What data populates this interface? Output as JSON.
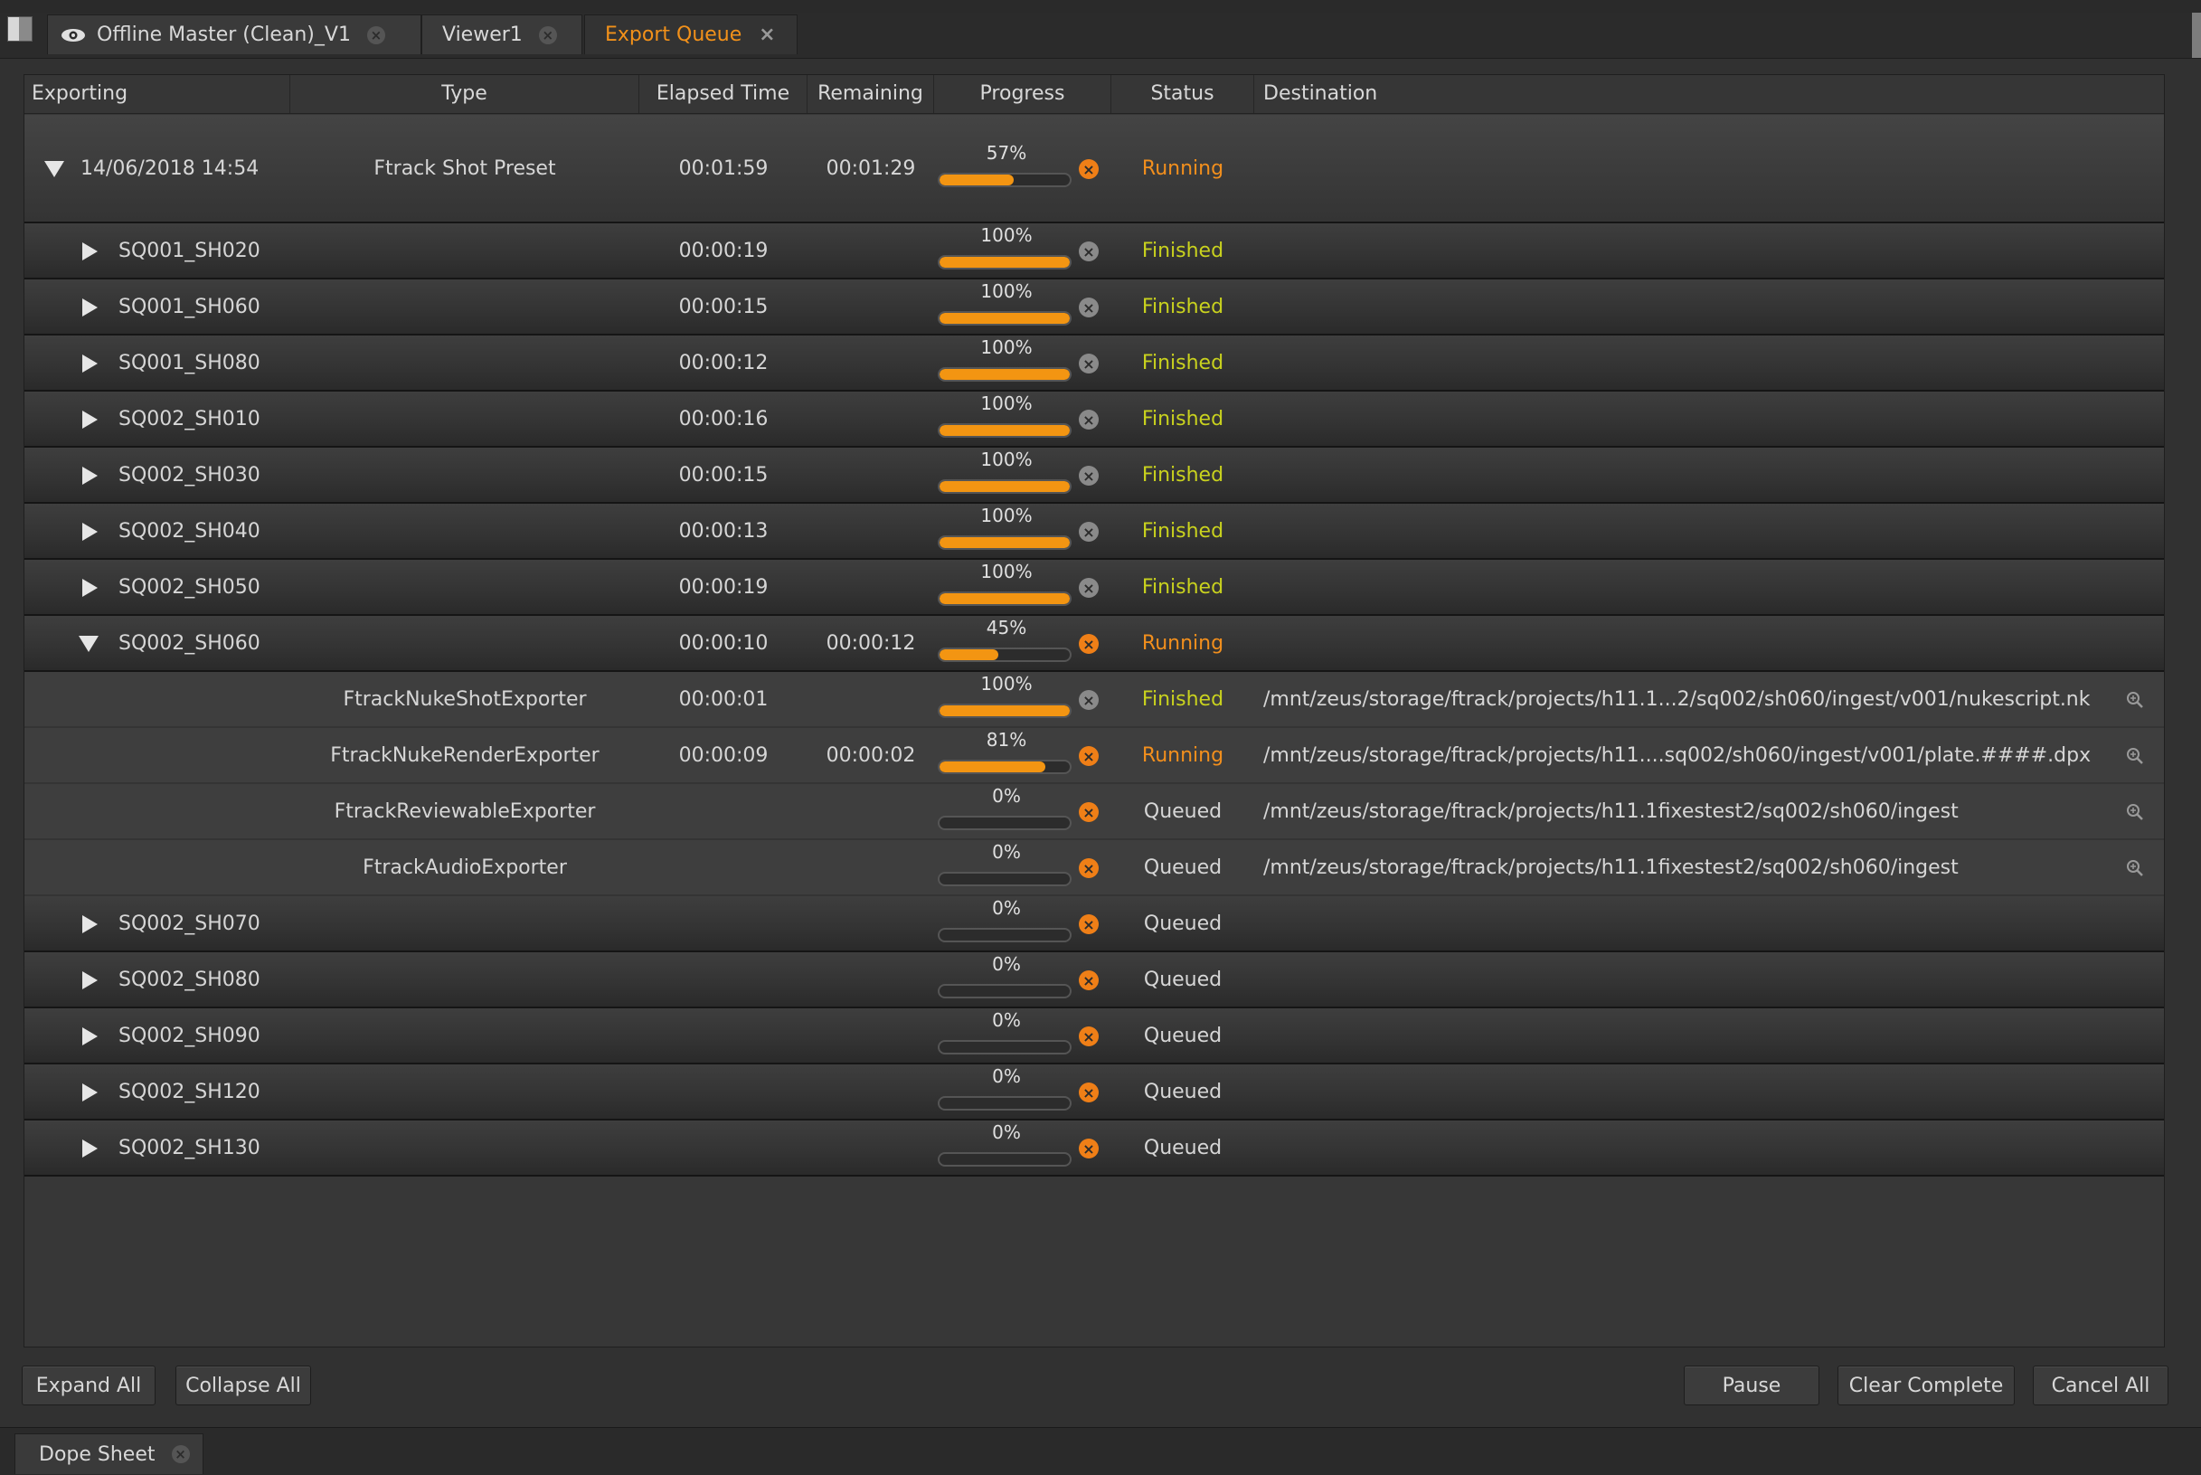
{
  "tabs": [
    {
      "label": "Offline Master (Clean)_V1",
      "icon": "eye-icon"
    },
    {
      "label": "Viewer1"
    },
    {
      "label": "Export Queue",
      "active": true
    }
  ],
  "columns": [
    "Exporting",
    "Type",
    "Elapsed Time",
    "Remaining",
    "Progress",
    "Status",
    "Destination"
  ],
  "rows": [
    {
      "kind": "top",
      "expanded": true,
      "name": "14/06/2018 14:54",
      "type": "Ftrack Shot Preset",
      "elapsed": "00:01:59",
      "remaining": "00:01:29",
      "progress": 57,
      "progress_label": "57%",
      "status": "Running",
      "destination": ""
    },
    {
      "kind": "shot",
      "expanded": false,
      "name": "SQ001_SH020",
      "type": "",
      "elapsed": "00:00:19",
      "remaining": "",
      "progress": 100,
      "progress_label": "100%",
      "status": "Finished",
      "destination": ""
    },
    {
      "kind": "shot",
      "expanded": false,
      "name": "SQ001_SH060",
      "type": "",
      "elapsed": "00:00:15",
      "remaining": "",
      "progress": 100,
      "progress_label": "100%",
      "status": "Finished",
      "destination": ""
    },
    {
      "kind": "shot",
      "expanded": false,
      "name": "SQ001_SH080",
      "type": "",
      "elapsed": "00:00:12",
      "remaining": "",
      "progress": 100,
      "progress_label": "100%",
      "status": "Finished",
      "destination": ""
    },
    {
      "kind": "shot",
      "expanded": false,
      "name": "SQ002_SH010",
      "type": "",
      "elapsed": "00:00:16",
      "remaining": "",
      "progress": 100,
      "progress_label": "100%",
      "status": "Finished",
      "destination": ""
    },
    {
      "kind": "shot",
      "expanded": false,
      "name": "SQ002_SH030",
      "type": "",
      "elapsed": "00:00:15",
      "remaining": "",
      "progress": 100,
      "progress_label": "100%",
      "status": "Finished",
      "destination": ""
    },
    {
      "kind": "shot",
      "expanded": false,
      "name": "SQ002_SH040",
      "type": "",
      "elapsed": "00:00:13",
      "remaining": "",
      "progress": 100,
      "progress_label": "100%",
      "status": "Finished",
      "destination": ""
    },
    {
      "kind": "shot",
      "expanded": false,
      "name": "SQ002_SH050",
      "type": "",
      "elapsed": "00:00:19",
      "remaining": "",
      "progress": 100,
      "progress_label": "100%",
      "status": "Finished",
      "destination": ""
    },
    {
      "kind": "shot",
      "expanded": true,
      "name": "SQ002_SH060",
      "type": "",
      "elapsed": "00:00:10",
      "remaining": "00:00:12",
      "progress": 45,
      "progress_label": "45%",
      "status": "Running",
      "destination": ""
    },
    {
      "kind": "sub",
      "name": "",
      "type": "FtrackNukeShotExporter",
      "elapsed": "00:00:01",
      "remaining": "",
      "progress": 100,
      "progress_label": "100%",
      "status": "Finished",
      "destination": "/mnt/zeus/storage/ftrack/projects/h11.1...2/sq002/sh060/ingest/v001/nukescript.nk"
    },
    {
      "kind": "sub",
      "name": "",
      "type": "FtrackNukeRenderExporter",
      "elapsed": "00:00:09",
      "remaining": "00:00:02",
      "progress": 81,
      "progress_label": "81%",
      "status": "Running",
      "destination": "/mnt/zeus/storage/ftrack/projects/h11....sq002/sh060/ingest/v001/plate.####.dpx"
    },
    {
      "kind": "sub",
      "name": "",
      "type": "FtrackReviewableExporter",
      "elapsed": "",
      "remaining": "",
      "progress": 0,
      "progress_label": "0%",
      "status": "Queued",
      "destination": "/mnt/zeus/storage/ftrack/projects/h11.1fixestest2/sq002/sh060/ingest"
    },
    {
      "kind": "sub",
      "name": "",
      "type": "FtrackAudioExporter",
      "elapsed": "",
      "remaining": "",
      "progress": 0,
      "progress_label": "0%",
      "status": "Queued",
      "destination": "/mnt/zeus/storage/ftrack/projects/h11.1fixestest2/sq002/sh060/ingest"
    },
    {
      "kind": "shot",
      "expanded": false,
      "name": "SQ002_SH070",
      "type": "",
      "elapsed": "",
      "remaining": "",
      "progress": 0,
      "progress_label": "0%",
      "status": "Queued",
      "destination": ""
    },
    {
      "kind": "shot",
      "expanded": false,
      "name": "SQ002_SH080",
      "type": "",
      "elapsed": "",
      "remaining": "",
      "progress": 0,
      "progress_label": "0%",
      "status": "Queued",
      "destination": ""
    },
    {
      "kind": "shot",
      "expanded": false,
      "name": "SQ002_SH090",
      "type": "",
      "elapsed": "",
      "remaining": "",
      "progress": 0,
      "progress_label": "0%",
      "status": "Queued",
      "destination": ""
    },
    {
      "kind": "shot",
      "expanded": false,
      "name": "SQ002_SH120",
      "type": "",
      "elapsed": "",
      "remaining": "",
      "progress": 0,
      "progress_label": "0%",
      "status": "Queued",
      "destination": ""
    },
    {
      "kind": "shot",
      "expanded": false,
      "name": "SQ002_SH130",
      "type": "",
      "elapsed": "",
      "remaining": "",
      "progress": 0,
      "progress_label": "0%",
      "status": "Queued",
      "destination": ""
    }
  ],
  "buttons": {
    "expand_all": "Expand All",
    "collapse_all": "Collapse All",
    "pause": "Pause",
    "clear_complete": "Clear Complete",
    "cancel_all": "Cancel All"
  },
  "bottom_tab": {
    "label": "Dope Sheet"
  },
  "colors": {
    "accent": "#f39512",
    "running": "#f28f1d",
    "finished": "#c9d21e"
  }
}
